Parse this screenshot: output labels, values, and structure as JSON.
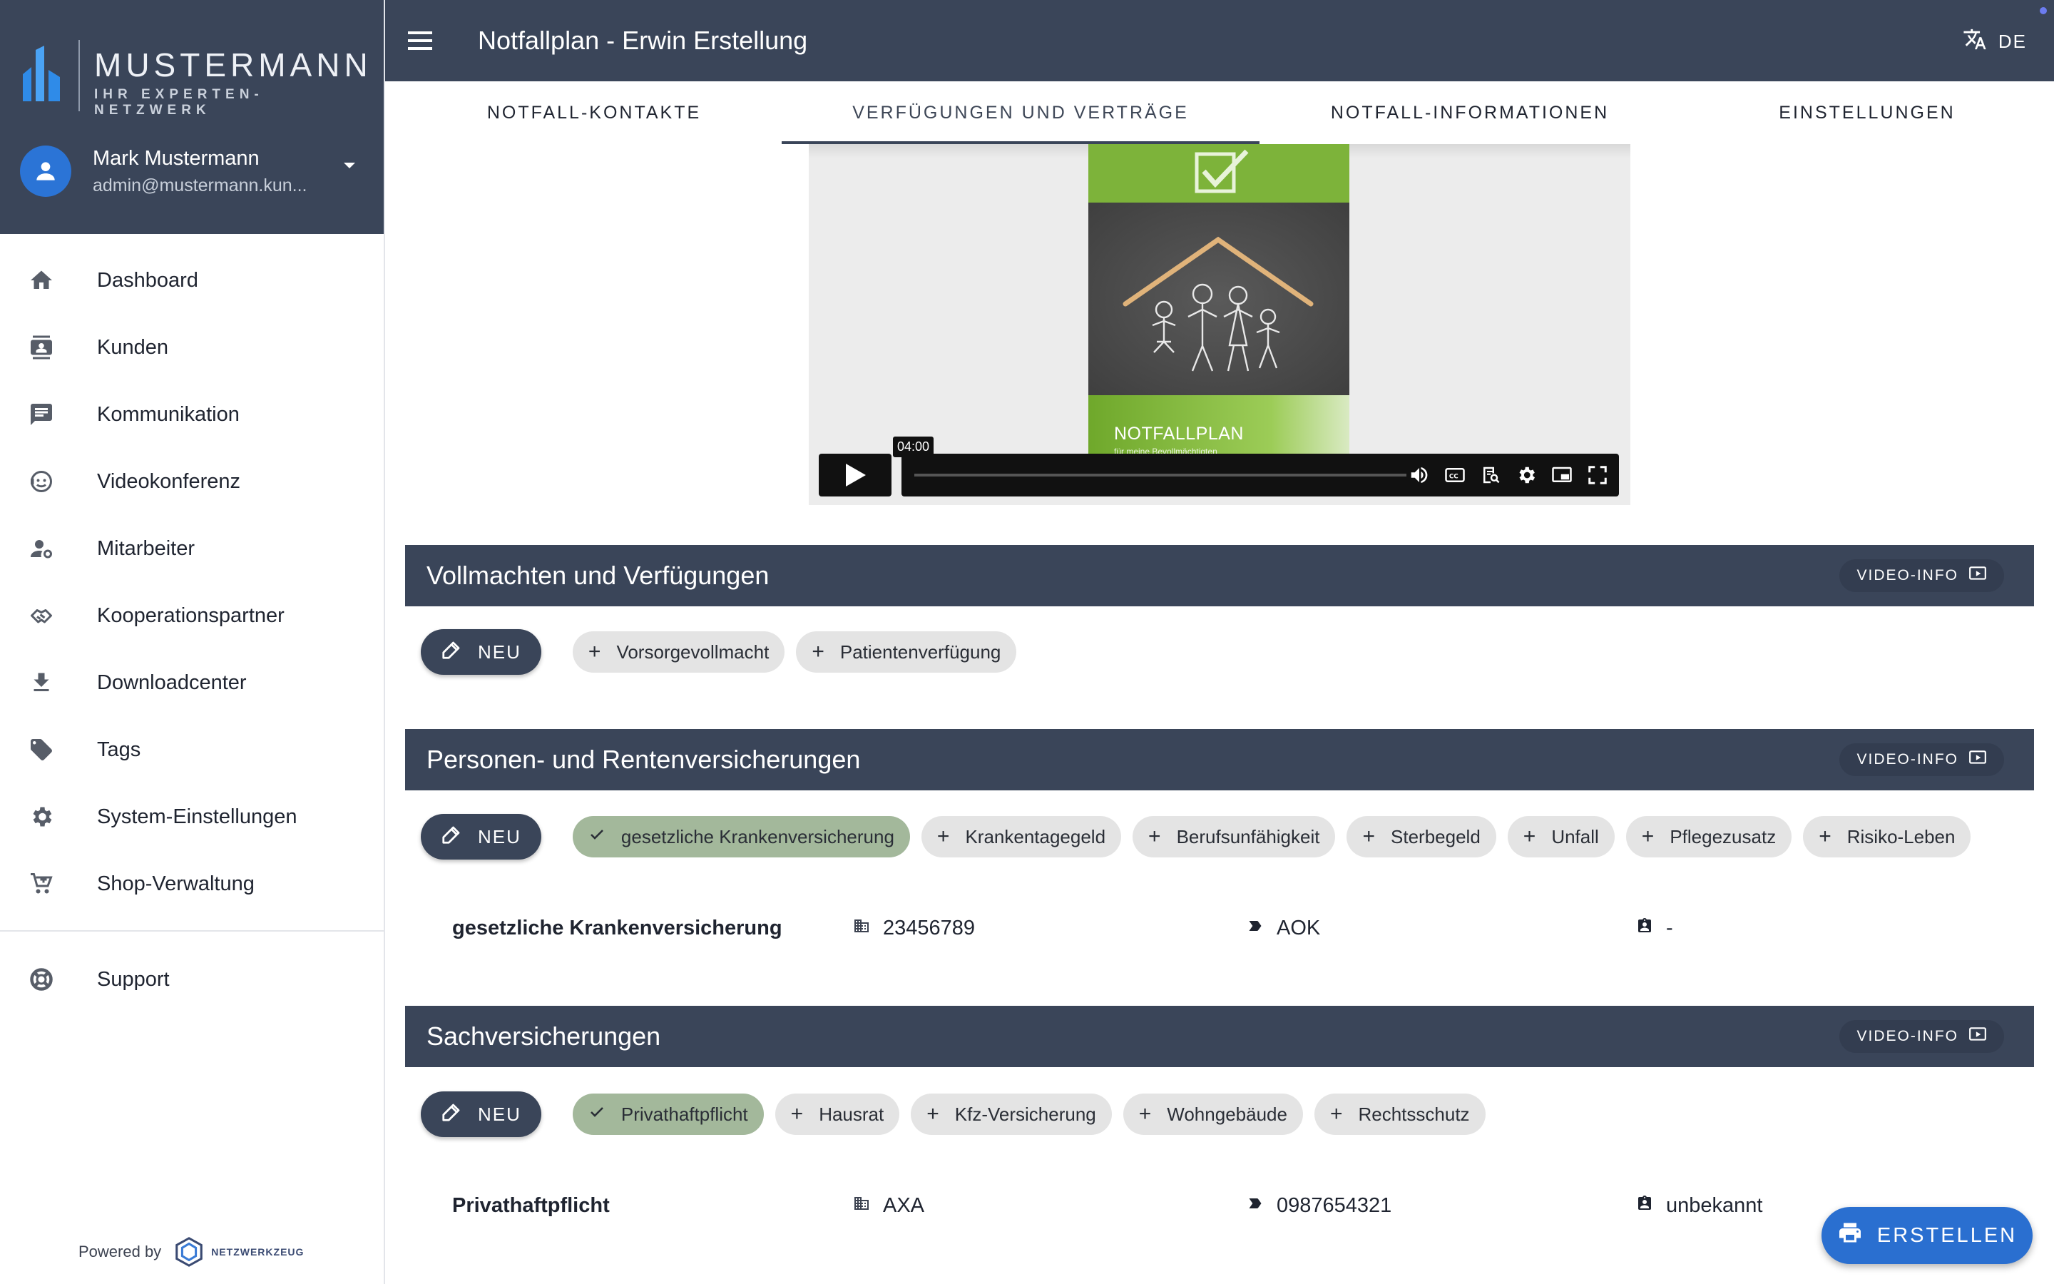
{
  "brand": {
    "name": "MUSTERMANN",
    "tagline": "IHR EXPERTEN-NETZWERK",
    "colors": {
      "header": "#3a4559",
      "accent": "#2a6fd0",
      "chip_selected": "#a3b89b"
    }
  },
  "user": {
    "name": "Mark Mustermann",
    "email": "admin@mustermann.kun..."
  },
  "sidebar": {
    "items": [
      {
        "label": "Dashboard",
        "icon": "home-icon"
      },
      {
        "label": "Kunden",
        "icon": "contacts-icon"
      },
      {
        "label": "Kommunikation",
        "icon": "chat-icon"
      },
      {
        "label": "Videokonferenz",
        "icon": "video-chat-icon"
      },
      {
        "label": "Mitarbeiter",
        "icon": "user-settings-icon"
      },
      {
        "label": "Kooperationspartner",
        "icon": "handshake-icon"
      },
      {
        "label": "Downloadcenter",
        "icon": "download-icon"
      },
      {
        "label": "Tags",
        "icon": "tag-icon"
      },
      {
        "label": "System-Einstellungen",
        "icon": "gear-icon"
      },
      {
        "label": "Shop-Verwaltung",
        "icon": "cart-icon"
      }
    ],
    "support": {
      "label": "Support",
      "icon": "lifebuoy-icon"
    },
    "powered_by": "Powered by",
    "powered_brand": "NETZWERKZEUG"
  },
  "header": {
    "title": "Notfallplan - Erwin Erstellung",
    "language": "DE"
  },
  "tabs": [
    {
      "label": "NOTFALL-KONTAKTE",
      "active": false
    },
    {
      "label": "VERFÜGUNGEN UND VERTRÄGE",
      "active": true
    },
    {
      "label": "NOTFALL-INFORMATIONEN",
      "active": false
    },
    {
      "label": "EINSTELLUNGEN",
      "active": false
    }
  ],
  "video": {
    "time": "04:00",
    "cover_title": "NOTFALLPLAN",
    "cover_subtitle": "für meine Bevollmächtigten"
  },
  "sections": [
    {
      "title": "Vollmachten und Verfügungen",
      "video_info": "VIDEO-INFO",
      "new_label": "NEU",
      "chips": [
        {
          "label": "Vorsorgevollmacht",
          "selected": false
        },
        {
          "label": "Patientenverfügung",
          "selected": false
        }
      ],
      "rows": []
    },
    {
      "title": "Personen- und Rentenversicherungen",
      "video_info": "VIDEO-INFO",
      "new_label": "NEU",
      "chips": [
        {
          "label": "gesetzliche Krankenversicherung",
          "selected": true
        },
        {
          "label": "Krankentagegeld",
          "selected": false
        },
        {
          "label": "Berufsunfähigkeit",
          "selected": false
        },
        {
          "label": "Sterbegeld",
          "selected": false
        },
        {
          "label": "Unfall",
          "selected": false
        },
        {
          "label": "Pflegezusatz",
          "selected": false
        },
        {
          "label": "Risiko-Leben",
          "selected": false
        }
      ],
      "rows": [
        {
          "name": "gesetzliche Krankenversicherung",
          "col1": "23456789",
          "col2": "AOK",
          "col3": "-"
        }
      ]
    },
    {
      "title": "Sachversicherungen",
      "video_info": "VIDEO-INFO",
      "new_label": "NEU",
      "chips": [
        {
          "label": "Privathaftpflicht",
          "selected": true
        },
        {
          "label": "Hausrat",
          "selected": false
        },
        {
          "label": "Kfz-Versicherung",
          "selected": false
        },
        {
          "label": "Wohngebäude",
          "selected": false
        },
        {
          "label": "Rechtsschutz",
          "selected": false
        }
      ],
      "rows": [
        {
          "name": "Privathaftpflicht",
          "col1": "AXA",
          "col2": "0987654321",
          "col3": "unbekannt"
        }
      ]
    }
  ],
  "fab": {
    "label": "ERSTELLEN",
    "icon": "printer-icon"
  }
}
